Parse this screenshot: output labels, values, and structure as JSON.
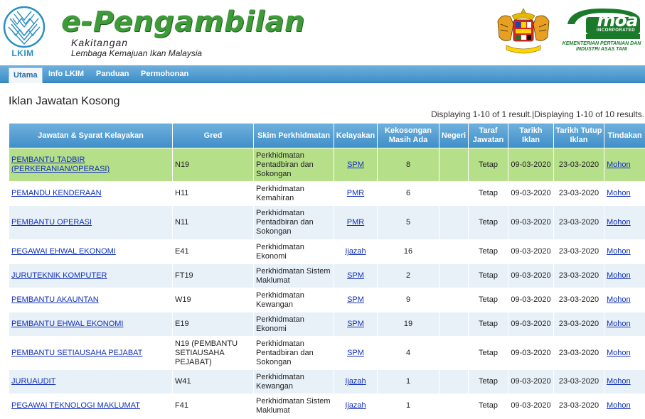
{
  "header": {
    "logo_label": "LKIM",
    "title": "e-Pengambilan",
    "subtitle1": "Kakitangan",
    "subtitle2": "Lembaga Kemajuan Ikan Malaysia",
    "moa_brand": "moa",
    "moa_incorporated": "INCORPORATED",
    "moa_ministry": "KEMENTERIAN PERTANIAN DAN INDUSTRI ASAS TANI"
  },
  "nav": {
    "items": [
      "Utama",
      "Info LKIM",
      "Panduan",
      "Permohonan"
    ],
    "active": "Utama"
  },
  "page": {
    "title": "Iklan Jawatan Kosong",
    "summary": "Displaying 1-10 of 1 result.|Displaying 1-10 of 10 results."
  },
  "table": {
    "columns": [
      "Jawatan & Syarat Kelayakan",
      "Gred",
      "Skim Perkhidmatan",
      "Kelayakan",
      "Kekosongan Masih Ada",
      "Negeri",
      "Taraf Jawatan",
      "Tarikh Iklan",
      "Tarikh Tutup Iklan",
      "Tindakan"
    ],
    "rows": [
      {
        "jawatan": "PEMBANTU TADBIR (PERKERANIAN/OPERASI)",
        "gred": "N19",
        "skim": "Perkhidmatan Pentadbiran dan Sokongan",
        "kelayakan": "SPM",
        "kekosongan": "8",
        "negeri": "",
        "taraf": "Tetap",
        "tarikh_iklan": "09-03-2020",
        "tarikh_tutup": "23-03-2020",
        "tindakan": "Mohon"
      },
      {
        "jawatan": "PEMANDU KENDERAAN",
        "gred": "H11",
        "skim": "Perkhidmatan Kemahiran",
        "kelayakan": "PMR",
        "kekosongan": "6",
        "negeri": "",
        "taraf": "Tetap",
        "tarikh_iklan": "09-03-2020",
        "tarikh_tutup": "23-03-2020",
        "tindakan": "Mohon"
      },
      {
        "jawatan": "PEMBANTU OPERASI",
        "gred": "N11",
        "skim": "Perkhidmatan Pentadbiran dan Sokongan",
        "kelayakan": "PMR",
        "kekosongan": "5",
        "negeri": "",
        "taraf": "Tetap",
        "tarikh_iklan": "09-03-2020",
        "tarikh_tutup": "23-03-2020",
        "tindakan": "Mohon"
      },
      {
        "jawatan": "PEGAWAI EHWAL EKONOMI",
        "gred": "E41",
        "skim": "Perkhidmatan Ekonomi",
        "kelayakan": "Ijazah",
        "kekosongan": "16",
        "negeri": "",
        "taraf": "Tetap",
        "tarikh_iklan": "09-03-2020",
        "tarikh_tutup": "23-03-2020",
        "tindakan": "Mohon"
      },
      {
        "jawatan": "JURUTEKNIK KOMPUTER",
        "gred": "FT19",
        "skim": "Perkhidmatan Sistem Maklumat",
        "kelayakan": "SPM",
        "kekosongan": "2",
        "negeri": "",
        "taraf": "Tetap",
        "tarikh_iklan": "09-03-2020",
        "tarikh_tutup": "23-03-2020",
        "tindakan": "Mohon"
      },
      {
        "jawatan": "PEMBANTU AKAUNTAN",
        "gred": "W19",
        "skim": "Perkhidmatan Kewangan",
        "kelayakan": "SPM",
        "kekosongan": "9",
        "negeri": "",
        "taraf": "Tetap",
        "tarikh_iklan": "09-03-2020",
        "tarikh_tutup": "23-03-2020",
        "tindakan": "Mohon"
      },
      {
        "jawatan": "PEMBANTU EHWAL EKONOMI",
        "gred": "E19",
        "skim": "Perkhidmatan Ekonomi",
        "kelayakan": "SPM",
        "kekosongan": "19",
        "negeri": "",
        "taraf": "Tetap",
        "tarikh_iklan": "09-03-2020",
        "tarikh_tutup": "23-03-2020",
        "tindakan": "Mohon"
      },
      {
        "jawatan": "PEMBANTU SETIAUSAHA PEJABAT",
        "gred": "N19 (PEMBANTU SETIAUSAHA PEJABAT)",
        "skim": "Perkhidmatan Pentadbiran dan Sokongan",
        "kelayakan": "SPM",
        "kekosongan": "4",
        "negeri": "",
        "taraf": "Tetap",
        "tarikh_iklan": "09-03-2020",
        "tarikh_tutup": "23-03-2020",
        "tindakan": "Mohon"
      },
      {
        "jawatan": "JURUAUDIT",
        "gred": "W41",
        "skim": "Perkhidmatan Kewangan",
        "kelayakan": "Ijazah",
        "kekosongan": "1",
        "negeri": "",
        "taraf": "Tetap",
        "tarikh_iklan": "09-03-2020",
        "tarikh_tutup": "23-03-2020",
        "tindakan": "Mohon"
      },
      {
        "jawatan": "PEGAWAI TEKNOLOGI MAKLUMAT",
        "gred": "F41",
        "skim": "Perkhidmatan Sistem Maklumat",
        "kelayakan": "Ijazah",
        "kekosongan": "1",
        "negeri": "",
        "taraf": "Tetap",
        "tarikh_iklan": "09-03-2020",
        "tarikh_tutup": "23-03-2020",
        "tindakan": "Mohon"
      }
    ]
  },
  "colors": {
    "brand_green": "#3f9a3a",
    "nav_blue": "#3d8ec8",
    "selected_row": "#b6df8a",
    "alt_row": "#e8f1f8",
    "link": "#1230b8"
  }
}
